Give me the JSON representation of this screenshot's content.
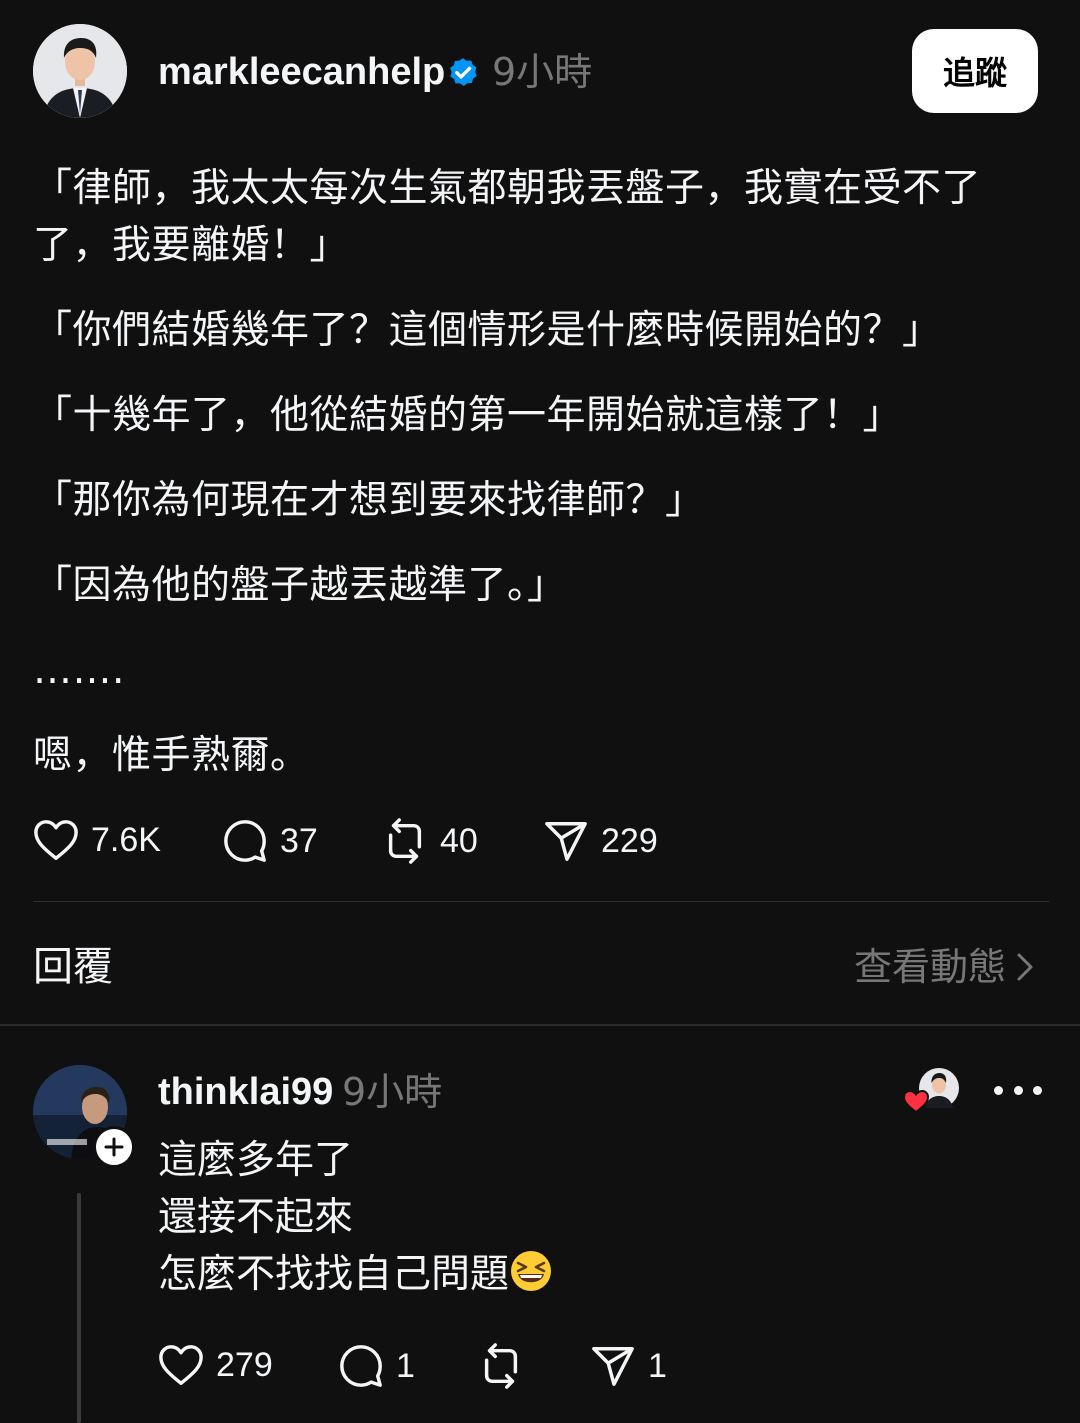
{
  "post": {
    "username": "markleecanhelp",
    "time": "9小時",
    "follow_label": "追蹤",
    "paragraphs": [
      "「律師，我太太每次生氣都朝我丟盤子，我實在受不了了，我要離婚！」",
      "「你們結婚幾年了？這個情形是什麼時候開始的？」",
      "「十幾年了，他從結婚的第一年開始就這樣了！」",
      "「那你為何現在才想到要來找律師？」",
      "「因為他的盤子越丟越準了。」",
      "…….",
      "嗯，惟手熟爾。"
    ],
    "likes": "7.6K",
    "comments": "37",
    "reposts": "40",
    "shares": "229"
  },
  "replies_header": {
    "title": "回覆",
    "view_activity": "查看動態"
  },
  "reply": {
    "username": "thinklai99",
    "time": "9小時",
    "lines": [
      "這麼多年了",
      "還接不起來",
      "怎麼不找找自己問題"
    ],
    "emoji": "grinning-squinting-face",
    "likes": "279",
    "comments": "1",
    "reposts": "",
    "shares": "1"
  },
  "colors": {
    "background": "#101010",
    "text": "#f3f5f7",
    "secondary": "#777777",
    "verified": "#0095f6",
    "heart": "#ff3040"
  },
  "icons": [
    "verified-badge-icon",
    "heart-icon",
    "comment-icon",
    "repost-icon",
    "share-icon",
    "chevron-right-icon",
    "plus-icon",
    "more-icon"
  ]
}
